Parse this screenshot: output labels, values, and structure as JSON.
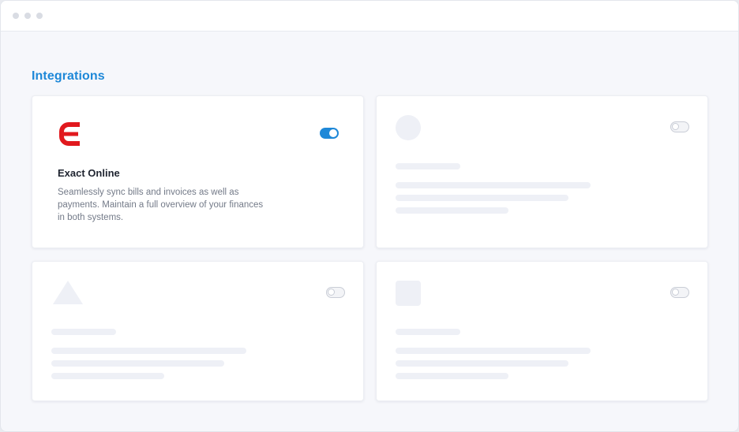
{
  "section": {
    "title": "Integrations"
  },
  "integrations": [
    {
      "name": "Exact Online",
      "description": "Seamlessly sync bills and invoices as well as payments. Maintain a full overview of your finances in both systems.",
      "enabled": true,
      "logo_icon": "exact-online-logo-icon",
      "brand_color": "#e1191e"
    },
    {
      "enabled": false,
      "placeholder_icon": "circle-placeholder-icon"
    },
    {
      "enabled": false,
      "placeholder_icon": "triangle-placeholder-icon"
    },
    {
      "enabled": false,
      "placeholder_icon": "square-placeholder-icon"
    }
  ],
  "colors": {
    "accent": "#1e88d8",
    "toggle_off_border": "#c9cdd6",
    "skeleton": "#eef0f6"
  }
}
